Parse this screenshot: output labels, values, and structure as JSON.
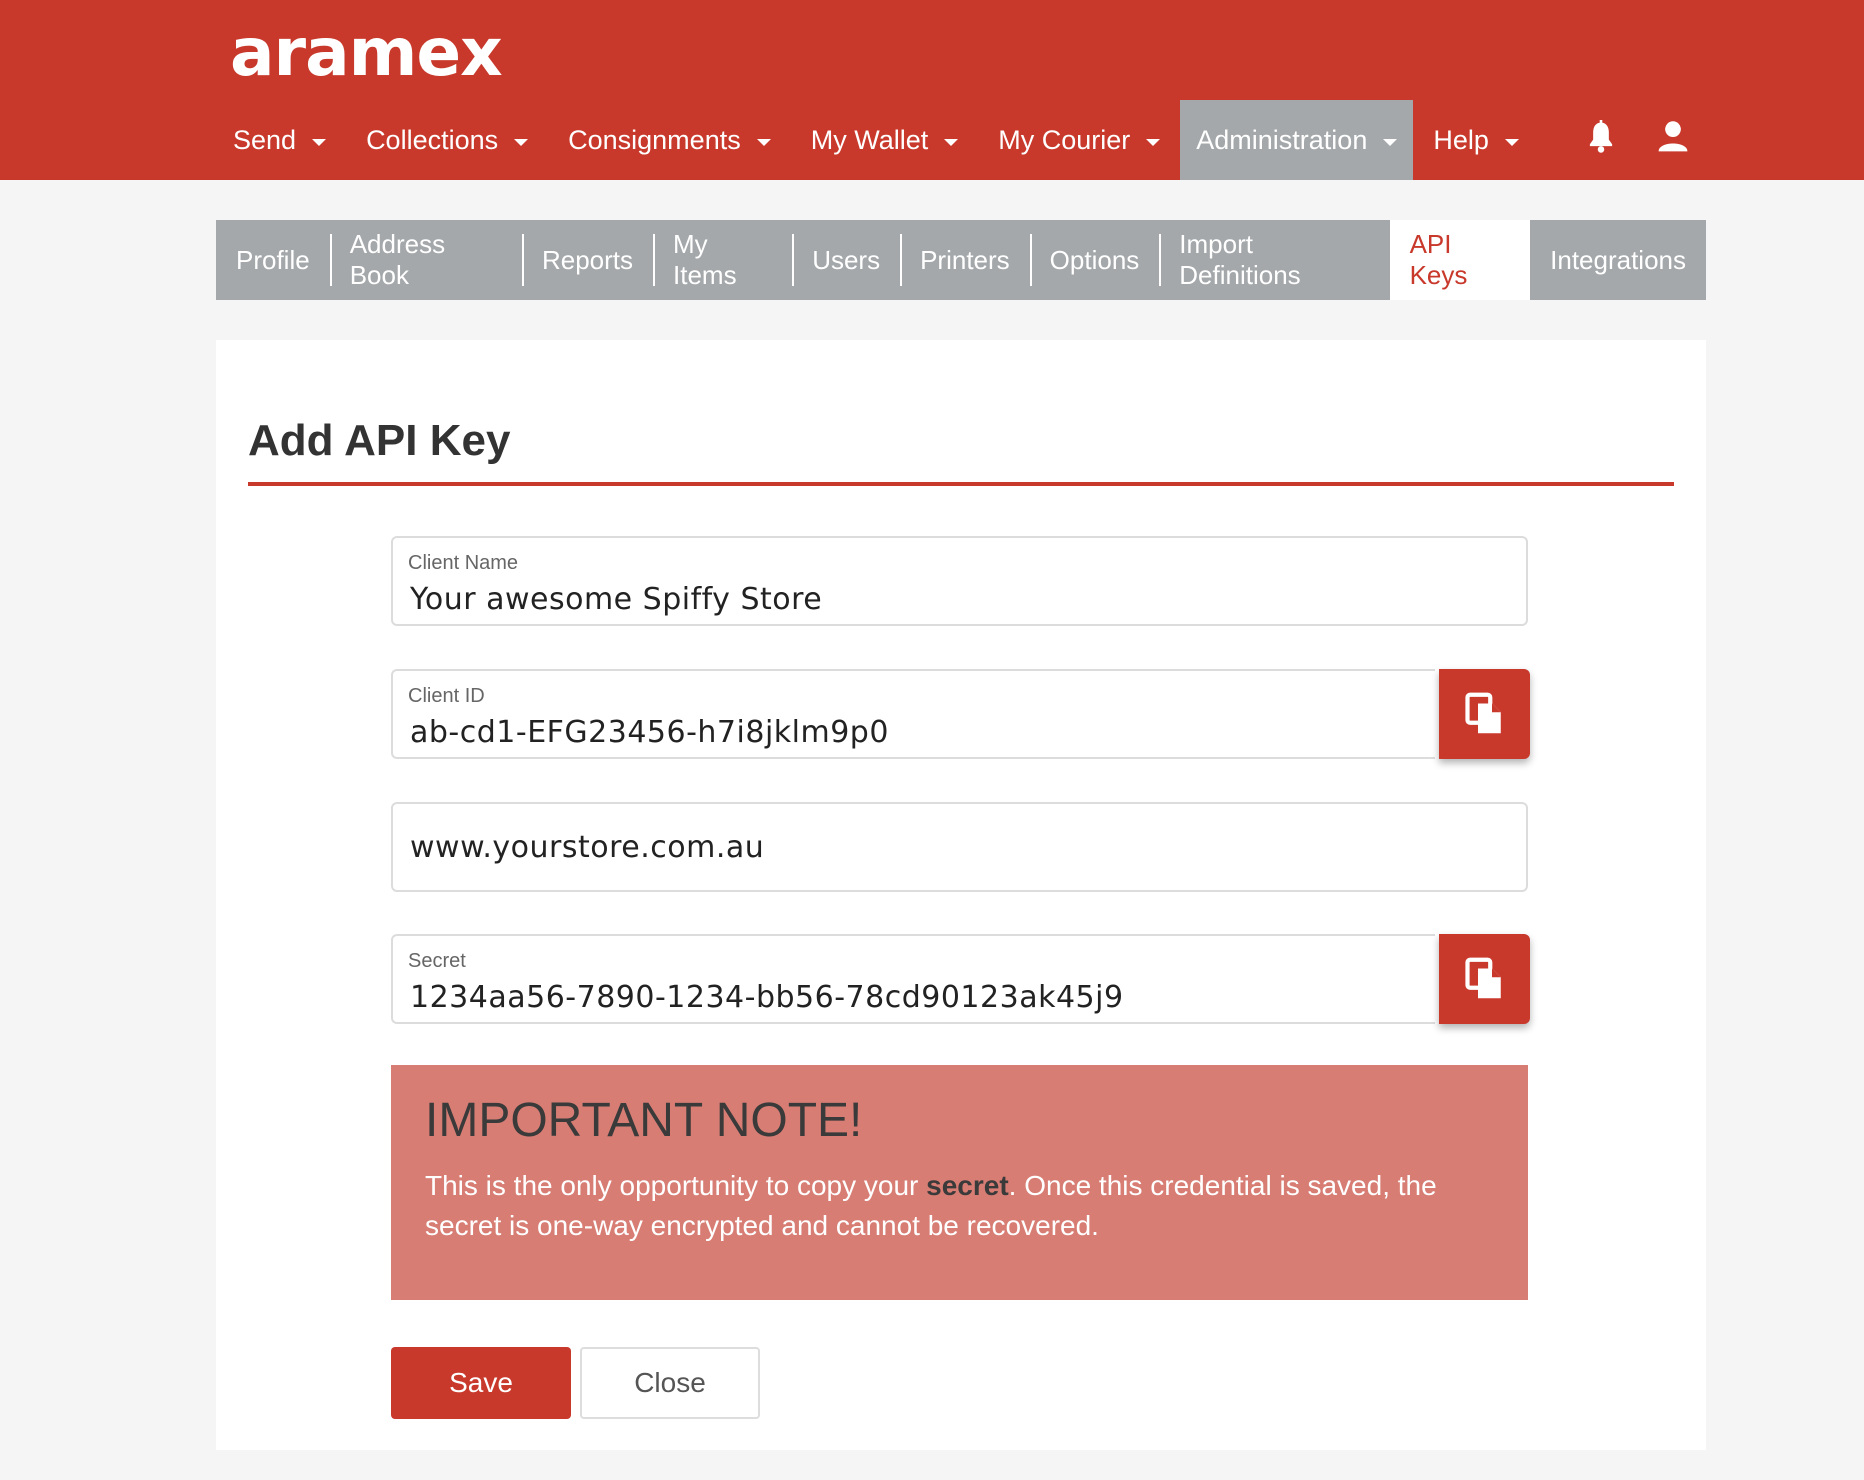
{
  "brand": {
    "logo_text": "aramex",
    "color": "#c8392c"
  },
  "nav": {
    "items": [
      {
        "label": "Send",
        "active": false
      },
      {
        "label": "Collections",
        "active": false
      },
      {
        "label": "Consignments",
        "active": false
      },
      {
        "label": "My Wallet",
        "active": false
      },
      {
        "label": "My Courier",
        "active": false
      },
      {
        "label": "Administration",
        "active": true
      },
      {
        "label": "Help",
        "active": false
      }
    ],
    "icons": [
      "bell-icon",
      "user-icon"
    ]
  },
  "subtabs": [
    {
      "label": "Profile"
    },
    {
      "label": "Address Book"
    },
    {
      "label": "Reports"
    },
    {
      "label": "My Items"
    },
    {
      "label": "Users"
    },
    {
      "label": "Printers"
    },
    {
      "label": "Options"
    },
    {
      "label": "Import Definitions"
    },
    {
      "label": "API Keys",
      "active": true
    },
    {
      "label": "Integrations"
    }
  ],
  "form": {
    "title": "Add API Key",
    "client_name": {
      "label": "Client Name",
      "value": "Your awesome Spiffy Store"
    },
    "client_id": {
      "label": "Client ID",
      "value": "ab-cd1-EFG23456-h7i8jklm9p0"
    },
    "url": {
      "value": "www.yourstore.com.au"
    },
    "secret": {
      "label": "Secret",
      "value": "1234aa56-7890-1234-bb56-78cd90123ak45j9"
    },
    "copy_icon": "copy-icon"
  },
  "note": {
    "title": "IMPORTANT NOTE!",
    "text_before": "This is the only opportunity to copy your ",
    "text_bold": "secret",
    "text_after": ". Once this credential is saved, the secret is one-way encrypted and cannot be recovered."
  },
  "actions": {
    "save_label": "Save",
    "close_label": "Close"
  }
}
